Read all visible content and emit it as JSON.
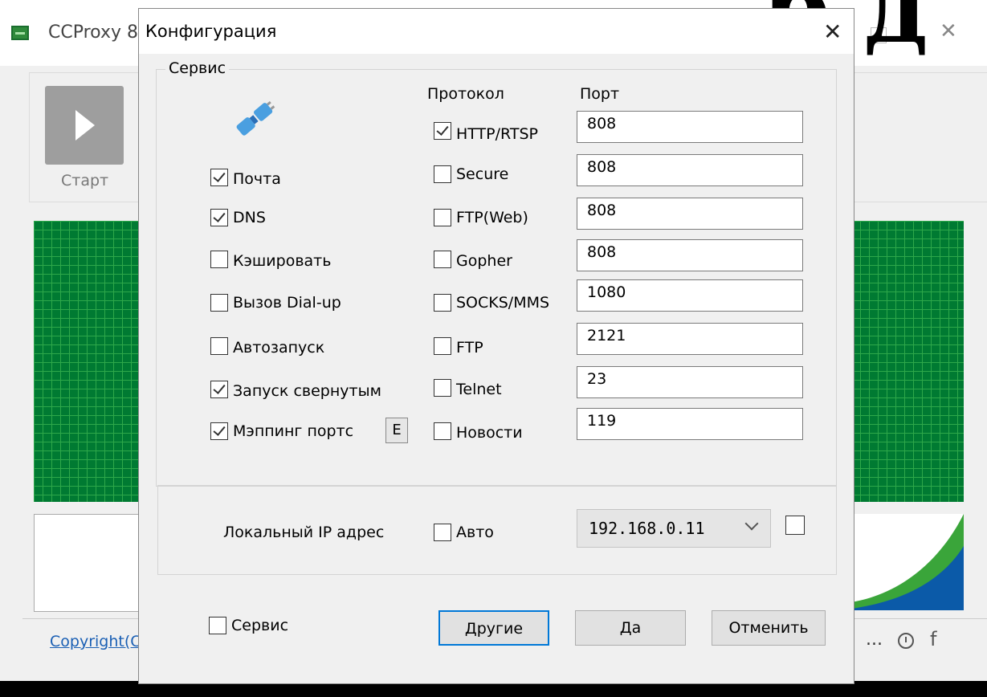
{
  "main_window": {
    "title": "CCProxy 8.",
    "start_label": "Старт",
    "copyright": "Copyright(C)",
    "status_ellipsis": "...",
    "fb_glyph": "f",
    "big_text": "р д"
  },
  "dialog": {
    "title": "Конфигурация",
    "close_glyph": "✕",
    "service_group_label": "Сервис",
    "protocol_header": "Протокол",
    "port_header": "Порт",
    "options": [
      {
        "label": "Почта",
        "checked": true
      },
      {
        "label": "DNS",
        "checked": true
      },
      {
        "label": "Кэшировать",
        "checked": false
      },
      {
        "label": "Вызов Dial-up",
        "checked": false
      },
      {
        "label": "Автозапуск",
        "checked": false
      },
      {
        "label": "Запуск свернутым",
        "checked": true
      },
      {
        "label": "Мэппинг портс",
        "checked": true
      }
    ],
    "e_button": "E",
    "protocols": [
      {
        "label": "HTTP/RTSP",
        "checked": true,
        "port": "808"
      },
      {
        "label": "Secure",
        "checked": false,
        "port": "808"
      },
      {
        "label": "FTP(Web)",
        "checked": false,
        "port": "808"
      },
      {
        "label": "Gopher",
        "checked": false,
        "port": "808"
      },
      {
        "label": "SOCKS/MMS",
        "checked": false,
        "port": "1080"
      },
      {
        "label": "FTP",
        "checked": false,
        "port": "2121"
      },
      {
        "label": "Telnet",
        "checked": false,
        "port": "23"
      },
      {
        "label": "Новости",
        "checked": false,
        "port": "119"
      }
    ],
    "local_ip_label": "Локальный IP адрес",
    "auto_label": "Авто",
    "auto_checked": false,
    "ip_value": "192.168.0.11",
    "ip_extra_checked": false,
    "service_bottom_label": "Сервис",
    "service_bottom_checked": false,
    "buttons": {
      "other": "Другие",
      "ok": "Да",
      "cancel": "Отменить"
    }
  },
  "icons": [
    "plug-icon",
    "close-icon",
    "chevron-down-icon",
    "play-icon",
    "clock-icon",
    "facebook-icon",
    "app-icon"
  ]
}
